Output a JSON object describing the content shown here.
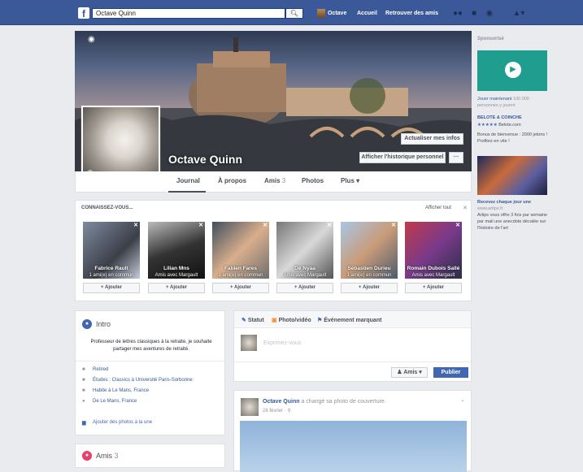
{
  "topbar": {
    "logo": "f",
    "search_value": "Octave Quinn",
    "search_icon": "search-icon",
    "user_name": "Octave",
    "home": "Accueil",
    "find_friends": "Retrouver des amis",
    "color": "#3b5998"
  },
  "profile": {
    "name": "Octave Quinn",
    "update_info": "Actualiser mes infos",
    "history": "Afficher l'historique personnel",
    "more_dots": "···",
    "tabs": [
      "Journal",
      "À propos",
      "Amis",
      "Photos",
      "Plus ▾"
    ],
    "friends_count": "3"
  },
  "pymk": {
    "title": "CONNAISSEZ-VOUS...",
    "show_all": "Afficher tout",
    "add_label": "Ajouter",
    "people": [
      {
        "name": "Fabrice Rault",
        "mutual": "1 ami(e) en commun"
      },
      {
        "name": "Lilian Mns",
        "mutual": "Amis avec Margault"
      },
      {
        "name": "Fabien Fares",
        "mutual": "1 ami(e) en commun"
      },
      {
        "name": "Dé Nyaa",
        "mutual": "Amis avec Margault"
      },
      {
        "name": "Sébastien Durieu",
        "mutual": "1 ami(e) en commun"
      },
      {
        "name": "Romain Dubois Sallé",
        "mutual": "Amis avec Margault"
      }
    ]
  },
  "sidebar": {
    "title": "Sponsorisé",
    "ad1_title": "Jouer maintenant",
    "ad1_meta": "100 000 personnes y jouent",
    "ad2_title": "BELOTE & COINCHE",
    "ad2_rating": "★★★★★",
    "ad2_site": "Belote.com",
    "ad2_desc": "Bonus de bienvenue : 2000 jetons ! Profitez-en vite !",
    "ad3_title": "Recevez chaque jour une",
    "ad3_site": "www.artips.fr",
    "ad3_desc": "Artips vous offre 3 fois par semaine par mail une anecdote décalée sur l'histoire de l'art"
  },
  "intro": {
    "title": "Intro",
    "bio": "Professeur de lettres classiques à la retraite, je souhaite partager mes aventures de retraité.",
    "items": [
      "Retired",
      "Études : Classics à Université Paris-Sorbonne",
      "Habite à Le Mans, France",
      "De Le Mans, France"
    ],
    "add_photos": "Ajouter des photos à la une"
  },
  "friends": {
    "title": "Amis",
    "count": "3"
  },
  "composer": {
    "status": "Statut",
    "photo": "Photo/vidéo",
    "event": "Événement marquant",
    "placeholder": "Exprimez-vous",
    "audience": "Amis ▾",
    "publish": "Publier"
  },
  "post": {
    "author": "Octave Quinn",
    "action": "a changé sa photo de couverture.",
    "date": "28 février · ⚲"
  }
}
